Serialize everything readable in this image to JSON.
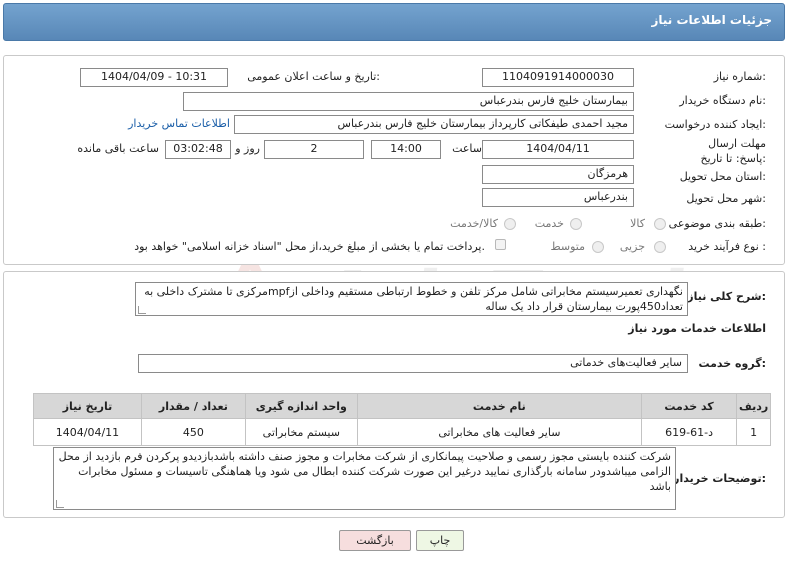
{
  "header": {
    "title": "جزئیات اطلاعات نیاز"
  },
  "form": {
    "need_number_label": "شماره نیاز:",
    "need_number": "1104091914000030",
    "announce_label": "تاریخ و ساعت اعلان عمومی:",
    "announce_value": "1404/04/09 - 10:31",
    "buyer_org_label": "نام دستگاه خریدار:",
    "buyer_org": "بیمارستان خلیج فارس بندرعباس",
    "creator_label": "ایجاد کننده درخواست:",
    "creator": "مجید احمدی طیفکاتی کارپرداز بیمارستان خلیج فارس بندرعباس",
    "contact_link": "اطلاعات تماس خریدار",
    "deadline_label": "مهلت ارسال پاسخ: تا تاریخ:",
    "deadline_date": "1404/04/11",
    "time_label": "ساعت",
    "deadline_time": "14:00",
    "days_value": "2",
    "days_label": "روز و",
    "remaining_time": "03:02:48",
    "remaining_label": "ساعت باقی مانده",
    "province_label": "استان محل تحویل:",
    "province": "هرمزگان",
    "city_label": "شهر محل تحویل:",
    "city": "بندرعباس",
    "category_label": "طبقه بندی موضوعی:",
    "category_options": [
      "کالا",
      "خدمت",
      "کالا/خدمت"
    ],
    "process_label": "نوع فرآیند خرید :",
    "process_options": [
      "جزیی",
      "متوسط"
    ],
    "payment_note": "پرداخت تمام یا بخشی از مبلغ خرید،از محل \"اسناد خزانه اسلامی\" خواهد بود."
  },
  "details": {
    "summary_label": "شرح کلی نیاز:",
    "summary_text": "نگهداری تعمیرسیستم مخابراتی شامل مرکز تلفن و خطوط ارتباطی مستقیم وداخلی ازmpfمرکزی تا مشترک داخلی به تعداد450پورت بیمارستان قرار داد یک ساله",
    "services_heading": "اطلاعات خدمات مورد نیاز",
    "service_group_label": "گروه خدمت:",
    "service_group": "سایر فعالیت‌های خدماتی",
    "table": {
      "headers": [
        "ردیف",
        "کد خدمت",
        "نام خدمت",
        "واحد اندازه گیری",
        "تعداد / مقدار",
        "تاریخ نیاز"
      ],
      "rows": [
        [
          "1",
          "د-61-619",
          "سایر فعالیت های مخابراتی",
          "سیستم مخابراتی",
          "450",
          "1404/04/11"
        ]
      ]
    },
    "buyer_notes_label": "توضیحات خریدار:",
    "buyer_notes": "شرکت کننده بایستی مجوز رسمی و صلاحیت پیمانکاری از شرکت مخابرات و مجوز صنف داشته باشدبازدیدو پرکردن فرم بازدید از محل الزامی میباشدودر سامانه بارگذاری نمایید درغیر این صورت شرکت کننده ابطال می شود ویا هماهنگی تاسیسات و مسئول مخابرات باشد"
  },
  "buttons": {
    "print": "چاپ",
    "back": "بازگشت"
  },
  "watermark": "AriaTender.net",
  "colors": {
    "header": "#6494c3",
    "link": "#1a5ea8",
    "back_button": "#f6dede",
    "print_button": "#eef7e4"
  }
}
